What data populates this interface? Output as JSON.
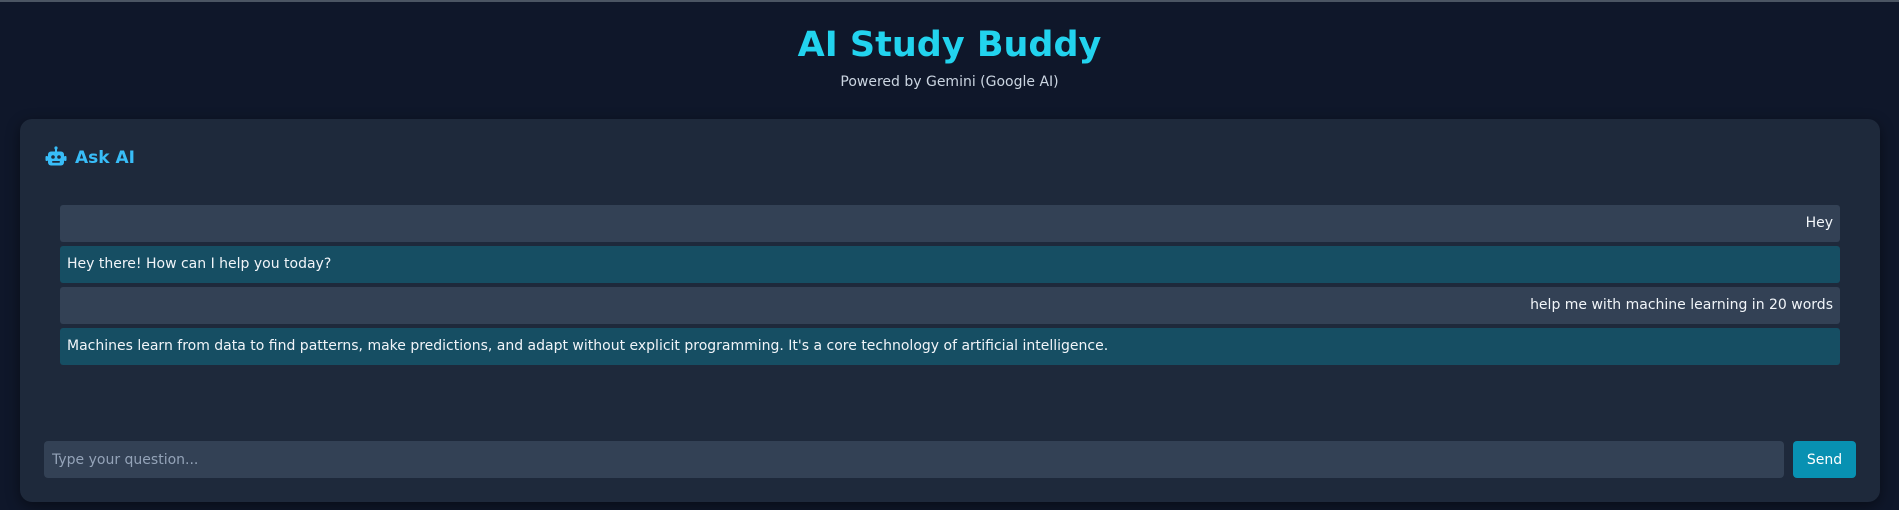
{
  "app": {
    "title": "AI Study Buddy",
    "subtitle": "Powered by Gemini (Google AI)"
  },
  "chat": {
    "header_icon": "robot-icon",
    "title": "Ask AI",
    "messages": [
      {
        "role": "user",
        "text": "Hey"
      },
      {
        "role": "ai",
        "text": "Hey there! How can I help you today?"
      },
      {
        "role": "user",
        "text": "help me with machine learning in 20 words"
      },
      {
        "role": "ai",
        "text": "Machines learn from data to find patterns, make predictions, and adapt without explicit programming. It's a core technology of artificial intelligence."
      }
    ],
    "input": {
      "value": "",
      "placeholder": "Type your question..."
    },
    "send_label": "Send"
  },
  "colors": {
    "page_background": "#0f172a",
    "card_background": "#1e293b",
    "accent": "#22d3ee",
    "user_bubble": "#334155",
    "ai_bubble": "#164e63",
    "send_button": "#0891b2"
  }
}
